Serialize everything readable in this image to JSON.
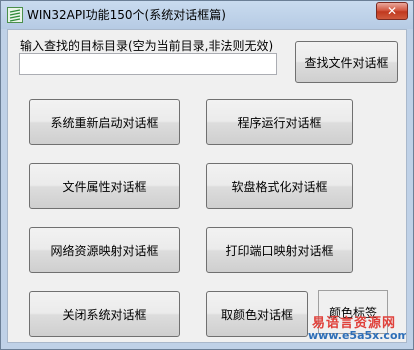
{
  "window": {
    "title": "WIN32API功能150个(系统对话框篇)",
    "close_label": "✕"
  },
  "caption": "输入查找的目标目录(空为当前目录,非法则无效)",
  "dir_input": {
    "value": "",
    "placeholder": ""
  },
  "buttons": {
    "find_file": "查找文件对话框",
    "restart": "系统重新启动对话框",
    "run": "程序运行对话框",
    "file_props": "文件属性对话框",
    "format": "软盘格式化对话框",
    "net_map": "网络资源映射对话框",
    "printer_map": "打印端口映射对话框",
    "shutdown": "关闭系统对话框",
    "color": "取颜色对话框"
  },
  "color_label": "颜色标签",
  "watermark": {
    "name": "易语言资源网",
    "url": "www.e5a5x.com"
  },
  "colors": {
    "titlebar": "#bfd1e7",
    "client": "#f0f0f0",
    "close": "#c9452c",
    "watermark_red": "#e0403a",
    "watermark_blue": "#2e6fb8"
  }
}
